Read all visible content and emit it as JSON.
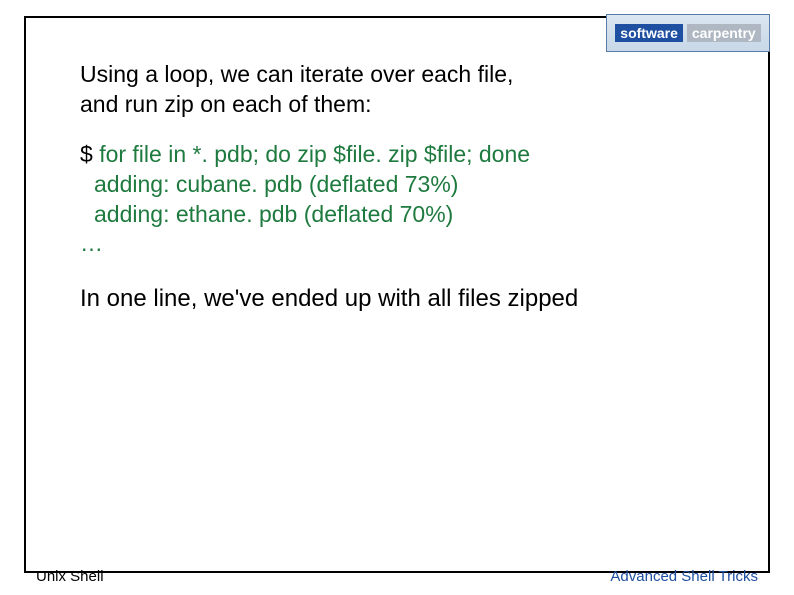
{
  "logo": {
    "word1": "software",
    "word2": "carpentry"
  },
  "intro": {
    "line1": "Using a loop, we can iterate over each file,",
    "line2": "and run zip on each of them:"
  },
  "terminal": {
    "prompt": "$",
    "command": "for file in *. pdb; do zip $file. zip $file; done",
    "out1": "adding: cubane. pdb (deflated 73%)",
    "out2": "adding: ethane. pdb (deflated 70%)",
    "out3": "…"
  },
  "conclusion": "In one line, we've ended up with all files zipped",
  "footer": {
    "left": "Unix Shell",
    "right": "Advanced Shell Tricks"
  }
}
